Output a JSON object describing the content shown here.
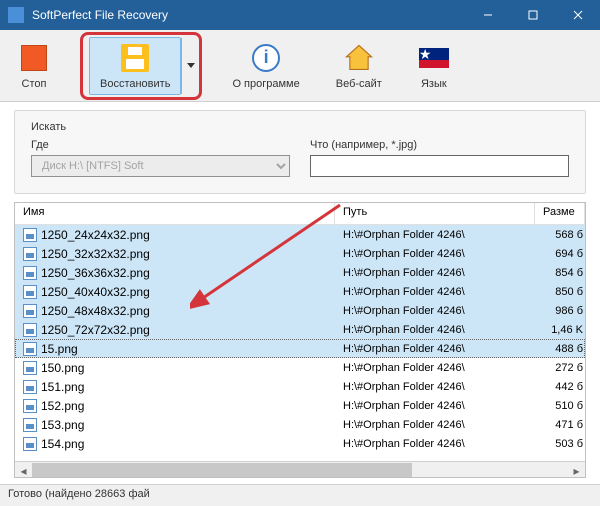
{
  "window": {
    "title": "SoftPerfect File Recovery"
  },
  "toolbar": {
    "stop": "Стоп",
    "restore": "Восстановить",
    "about": "О программе",
    "website": "Веб-сайт",
    "language": "Язык"
  },
  "search": {
    "section_label": "Искать",
    "where_label": "Где",
    "where_value": "Диск H:\\ [NTFS] Soft",
    "what_label": "Что (например, *.jpg)",
    "what_value": ""
  },
  "columns": {
    "name": "Имя",
    "path": "Путь",
    "size": "Разме"
  },
  "files": [
    {
      "name": "1250_24x24x32.png",
      "path": "H:\\#Orphan Folder 4246\\",
      "size": "568 б",
      "sel": true
    },
    {
      "name": "1250_32x32x32.png",
      "path": "H:\\#Orphan Folder 4246\\",
      "size": "694 б",
      "sel": true
    },
    {
      "name": "1250_36x36x32.png",
      "path": "H:\\#Orphan Folder 4246\\",
      "size": "854 б",
      "sel": true
    },
    {
      "name": "1250_40x40x32.png",
      "path": "H:\\#Orphan Folder 4246\\",
      "size": "850 б",
      "sel": true
    },
    {
      "name": "1250_48x48x32.png",
      "path": "H:\\#Orphan Folder 4246\\",
      "size": "986 б",
      "sel": true
    },
    {
      "name": "1250_72x72x32.png",
      "path": "H:\\#Orphan Folder 4246\\",
      "size": "1,46 K",
      "sel": true
    },
    {
      "name": "15.png",
      "path": "H:\\#Orphan Folder 4246\\",
      "size": "488 б",
      "sel": true,
      "focus": true
    },
    {
      "name": "150.png",
      "path": "H:\\#Orphan Folder 4246\\",
      "size": "272 б",
      "sel": false
    },
    {
      "name": "151.png",
      "path": "H:\\#Orphan Folder 4246\\",
      "size": "442 б",
      "sel": false
    },
    {
      "name": "152.png",
      "path": "H:\\#Orphan Folder 4246\\",
      "size": "510 б",
      "sel": false
    },
    {
      "name": "153.png",
      "path": "H:\\#Orphan Folder 4246\\",
      "size": "471 б",
      "sel": false
    },
    {
      "name": "154.png",
      "path": "H:\\#Orphan Folder 4246\\",
      "size": "503 б",
      "sel": false
    }
  ],
  "statusbar": "Готово (найдено 28663 фай",
  "colors": {
    "titlebar": "#236099",
    "selection": "#cde6f7",
    "annotation": "#d4353a"
  }
}
